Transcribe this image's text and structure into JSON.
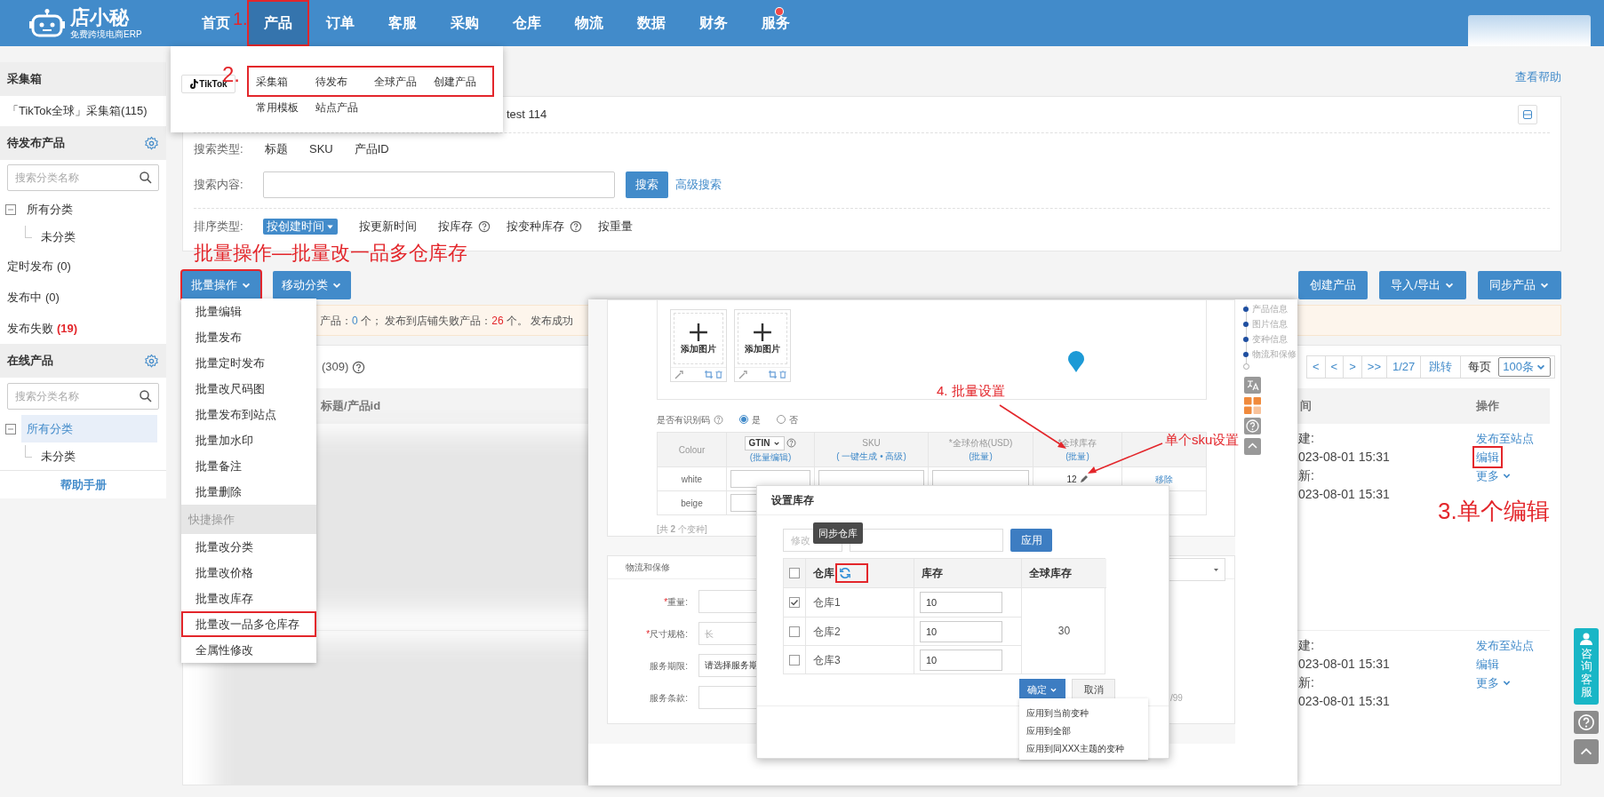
{
  "top_bar": {
    "logo_title": "店小秘",
    "logo_subtitle": "免费跨境电商ERP",
    "nav": [
      {
        "label": "首页",
        "selected": false,
        "highlighted": false,
        "dot": false
      },
      {
        "label": "产品",
        "selected": true,
        "highlighted": true,
        "dot": false
      },
      {
        "label": "订单",
        "selected": false,
        "highlighted": false,
        "dot": false
      },
      {
        "label": "客服",
        "selected": false,
        "highlighted": false,
        "dot": false
      },
      {
        "label": "采购",
        "selected": false,
        "highlighted": false,
        "dot": false
      },
      {
        "label": "仓库",
        "selected": false,
        "highlighted": false,
        "dot": false
      },
      {
        "label": "物流",
        "selected": false,
        "highlighted": false,
        "dot": false
      },
      {
        "label": "数据",
        "selected": false,
        "highlighted": false,
        "dot": false
      },
      {
        "label": "财务",
        "selected": false,
        "highlighted": false,
        "dot": false
      },
      {
        "label": "服务",
        "selected": false,
        "highlighted": false,
        "dot": true
      }
    ]
  },
  "product_menu": {
    "platform": "TikTok",
    "rows": [
      {
        "highlighted": true,
        "items": [
          "采集箱",
          "待发布",
          "全球产品",
          "创建产品"
        ]
      },
      {
        "highlighted": false,
        "items": [
          "常用模板",
          "站点产品"
        ]
      }
    ]
  },
  "sidebar": {
    "collect": {
      "title": "采集箱",
      "items": [
        "「TikTok全球」采集箱(115)"
      ]
    },
    "pending": {
      "title": "待发布产品",
      "search_placeholder": "搜索分类名称",
      "tree": [
        {
          "label": "所有分类",
          "selected": false,
          "expanded": true,
          "children": [
            {
              "label": "未分类",
              "selected": false
            }
          ]
        }
      ],
      "statuses": [
        {
          "label": "定时发布",
          "count": "(0)",
          "alert": false
        },
        {
          "label": "发布中",
          "count": "(0)",
          "alert": false
        },
        {
          "label": "发布失败",
          "count": "(19)",
          "alert": true
        }
      ]
    },
    "online": {
      "title": "在线产品",
      "search_placeholder": "搜索分类名称",
      "tree": [
        {
          "label": "所有分类",
          "selected": true,
          "expanded": true,
          "children": [
            {
              "label": "未分类",
              "selected": false
            }
          ]
        }
      ]
    },
    "help": "帮助手册"
  },
  "help_link": "查看帮助",
  "filter": {
    "cut_text": "test 114",
    "search_type": {
      "label": "搜索类型:",
      "options": [
        "标题",
        "SKU",
        "产品ID"
      ]
    },
    "search_content": {
      "label": "搜索内容:",
      "button": "搜索",
      "advanced": "高级搜索"
    },
    "sort": {
      "label": "排序类型:",
      "options": [
        {
          "label": "按创建时间",
          "selected": true,
          "help": false
        },
        {
          "label": "按更新时间",
          "selected": false,
          "help": false
        },
        {
          "label": "按库存",
          "selected": false,
          "help": true
        },
        {
          "label": "按变种库存",
          "selected": false,
          "help": true
        },
        {
          "label": "按重量",
          "selected": false,
          "help": false
        }
      ]
    }
  },
  "toolbar": {
    "left": [
      {
        "label": "批量操作",
        "highlighted": true
      },
      {
        "label": "移动分类",
        "highlighted": false
      }
    ],
    "right": [
      {
        "label": "创建产品",
        "caret": false
      },
      {
        "label": "导入/导出",
        "caret": true
      },
      {
        "label": "同步产品",
        "caret": true
      }
    ]
  },
  "batch_menu": [
    {
      "kind": "item",
      "label": "批量编辑",
      "highlighted": false
    },
    {
      "kind": "item",
      "label": "批量发布",
      "highlighted": false
    },
    {
      "kind": "item",
      "label": "批量定时发布",
      "highlighted": false
    },
    {
      "kind": "item",
      "label": "批量改尺码图",
      "highlighted": false
    },
    {
      "kind": "item",
      "label": "批量发布到站点",
      "highlighted": false
    },
    {
      "kind": "item",
      "label": "批量加水印",
      "highlighted": false
    },
    {
      "kind": "item",
      "label": "批量备注",
      "highlighted": false
    },
    {
      "kind": "item",
      "label": "批量删除",
      "highlighted": false
    },
    {
      "kind": "header",
      "label": "快捷操作"
    },
    {
      "kind": "item",
      "label": "批量改分类",
      "highlighted": false
    },
    {
      "kind": "item",
      "label": "批量改价格",
      "highlighted": false
    },
    {
      "kind": "item",
      "label": "批量改库存",
      "highlighted": false
    },
    {
      "kind": "item",
      "label": "批量改一品多仓库存",
      "highlighted": true
    },
    {
      "kind": "item",
      "label": "全属性修改",
      "highlighted": false
    }
  ],
  "notice": [
    {
      "text": "产品：",
      "color": "#555555"
    },
    {
      "text": "0",
      "color": "#428bca"
    },
    {
      "text": " 个； 发布到店铺失败产品：",
      "color": "#555555"
    },
    {
      "text": "26",
      "color": "#e3262b"
    },
    {
      "text": " 个。 发布成功",
      "color": "#555555"
    }
  ],
  "list_tab": {
    "count": "(309)"
  },
  "pagination": {
    "pages": [
      "<",
      "<",
      ">",
      ">>",
      "1/27"
    ],
    "jump": "跳转",
    "per_page_label": "每页",
    "per_page": "100条"
  },
  "table": {
    "columns": [
      "标题/产品id",
      "间",
      "操作"
    ],
    "rows": [
      {
        "created_label": "建:",
        "created": "023-08-01 15:31",
        "updated_label": "新:",
        "updated": "023-08-01 15:31",
        "actions": [
          {
            "label": "发布至站点",
            "highlighted": false,
            "caret": false
          },
          {
            "label": "编辑",
            "highlighted": true,
            "caret": false
          },
          {
            "label": "更多",
            "highlighted": false,
            "caret": true
          }
        ]
      },
      {
        "created_label": "建:",
        "created": "023-08-01 15:31",
        "updated_label": "新:",
        "updated": "023-08-01 15:31",
        "actions": [
          {
            "label": "发布至站点",
            "highlighted": false,
            "caret": false
          },
          {
            "label": "编辑",
            "highlighted": false,
            "caret": false
          },
          {
            "label": "更多",
            "highlighted": false,
            "caret": true
          }
        ]
      }
    ]
  },
  "float_buttons": {
    "service": "咨询客服"
  },
  "annotations": {
    "step1": "1.",
    "step2": "2.",
    "batch_note": "批量操作—批量改一品多仓库存",
    "step3": "3.单个编辑",
    "step4": "4. 批量设置",
    "sku_note": "单个sku设置"
  },
  "inset": {
    "side_nav": [
      "产品信息",
      "图片信息",
      "变种信息",
      "物流和保修"
    ],
    "image_slots": [
      "添加图片",
      "添加图片"
    ],
    "identifier": {
      "label": "是否有识别码",
      "options": [
        {
          "label": "是",
          "selected": true
        },
        {
          "label": "否",
          "selected": false
        }
      ]
    },
    "variant_columns": [
      {
        "kind": "text",
        "title": "Colour"
      },
      {
        "kind": "select",
        "title": "GTIN",
        "sub": "(批量编辑)"
      },
      {
        "kind": "text",
        "title": "SKU",
        "sub": "( 一键生成 • 高级)"
      },
      {
        "kind": "text",
        "title": "*全球价格(USD)",
        "sub": "(批量)"
      },
      {
        "kind": "text",
        "title": "*全球库存",
        "sub": "(批量)"
      }
    ],
    "variant_rows": [
      {
        "colour": "white",
        "stock": "12",
        "action": "移除"
      },
      {
        "colour": "beige"
      }
    ],
    "variant_count": "[共 **2** 个变种]",
    "logistics": {
      "title": "物流和保修",
      "fields": [
        {
          "mark": "*",
          "label": "重量:"
        },
        {
          "mark": "*",
          "label": "尺寸规格:",
          "placeholder": "长"
        },
        {
          "label": "服务期限:",
          "value": "请选择服务期"
        },
        {
          "label": "服务条款:"
        }
      ],
      "counter": "/99"
    },
    "modal": {
      "title": "设置库存",
      "input_placeholder": "修改",
      "apply": "应用",
      "tooltip": "同步仓库",
      "columns": [
        "仓库",
        "库存",
        "全球库存"
      ],
      "all_checked": false,
      "rows": [
        {
          "name": "仓库1",
          "checked": true,
          "stock": "10"
        },
        {
          "name": "仓库2",
          "checked": false,
          "stock": "10"
        },
        {
          "name": "仓库3",
          "checked": false,
          "stock": "10"
        }
      ],
      "total": "30",
      "confirm": "确定",
      "cancel": "取消",
      "confirm_menu": [
        "应用到当前变种",
        "应用到全部",
        "应用到同XXX主题的变种"
      ]
    }
  }
}
